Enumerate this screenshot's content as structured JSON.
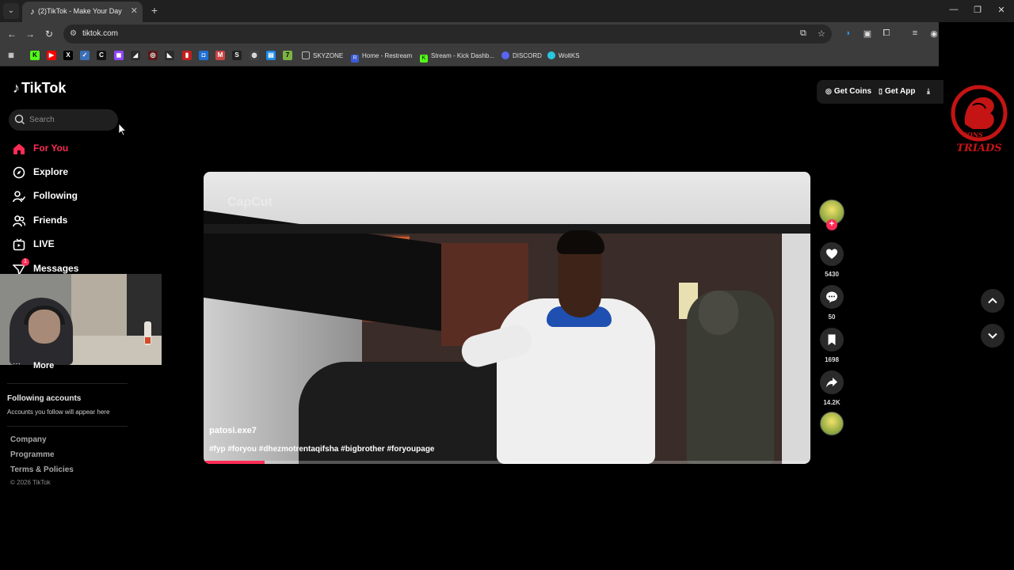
{
  "browser": {
    "tab_title": "(2)TikTok - Make Your Day",
    "url": "tiktok.com",
    "bookmarks": [
      {
        "label": "SKYZONE",
        "icon": "folder-icon"
      },
      {
        "label": "Home - Restream",
        "icon": "restream-icon"
      },
      {
        "label": "Stream - Kick Dashb...",
        "icon": "kick-icon"
      },
      {
        "label": "DISCORD",
        "icon": "discord-icon"
      },
      {
        "label": "WoltKS",
        "icon": "wolt-icon"
      }
    ]
  },
  "app": {
    "logo_text": "TikTok",
    "search_placeholder": "Search",
    "nav": [
      {
        "label": "For You",
        "icon": "home-icon",
        "active": true
      },
      {
        "label": "Explore",
        "icon": "compass-icon"
      },
      {
        "label": "Following",
        "icon": "following-icon"
      },
      {
        "label": "Friends",
        "icon": "friends-icon"
      },
      {
        "label": "LIVE",
        "icon": "live-icon"
      },
      {
        "label": "Messages",
        "icon": "messages-icon",
        "badge": "1"
      }
    ],
    "more_label": "More",
    "following_accounts": {
      "title": "Following accounts",
      "subtitle": "Accounts you follow will appear here"
    },
    "footer_links": [
      "Company",
      "Programme",
      "Terms & Policies"
    ],
    "copyright": "© 2026 TikTok",
    "header_actions": {
      "get_coins": "Get Coins",
      "get_app": "Get App"
    },
    "watermark_logo_text": "SONS TRIADS"
  },
  "video": {
    "watermark": "CapCut",
    "author": "patosi.exe7",
    "caption": "#fyp #foryou #dhezmotrentaqifsha #bigbrother #foryoupage",
    "progress": 0.1
  },
  "actions": {
    "likes": "5430",
    "comments": "50",
    "saves": "1698",
    "shares": "14.2K"
  },
  "colors": {
    "accent": "#fe2c55",
    "background": "#000000"
  }
}
